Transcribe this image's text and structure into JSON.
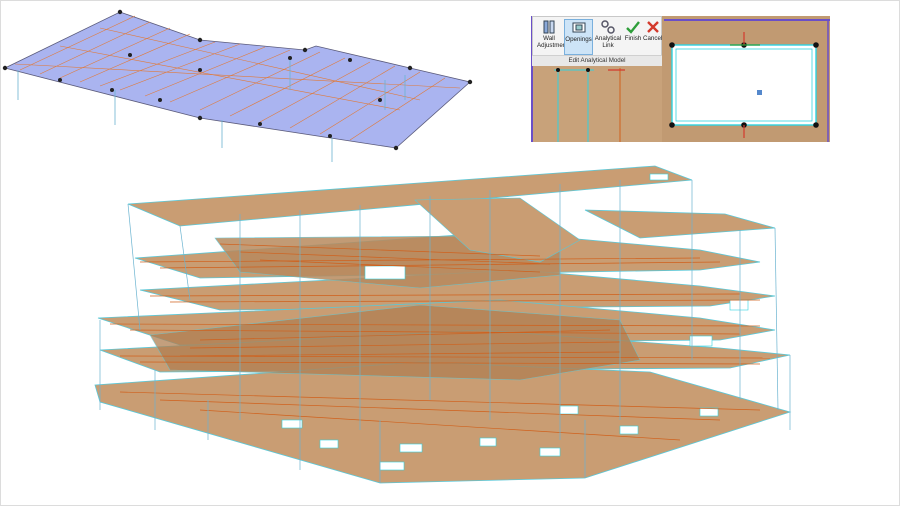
{
  "ribbon": {
    "panel_label": "Edit Analytical Model",
    "buttons": [
      {
        "line1": "Wall",
        "line2": "Adjustment",
        "icon": "wall-adjustment-icon"
      },
      {
        "line1": "Openings",
        "line2": "",
        "icon": "openings-icon",
        "selected": true
      },
      {
        "line1": "Analytical",
        "line2": "Link",
        "icon": "analytical-link-icon"
      },
      {
        "line1": "Finish",
        "line2": "",
        "icon": "checkmark-icon"
      },
      {
        "line1": "Cancel",
        "line2": "",
        "icon": "close-icon"
      }
    ]
  },
  "colors": {
    "slab": "#c99d73",
    "slab_edge": "#5ac8d8",
    "beam": "#d0601c",
    "floor_blue": "#aab4f0",
    "opening_edge": "#2fd3e0",
    "accent_purple": "#6a4fc8",
    "finish_green": "#2e9e3a",
    "cancel_red": "#d33a2c"
  }
}
